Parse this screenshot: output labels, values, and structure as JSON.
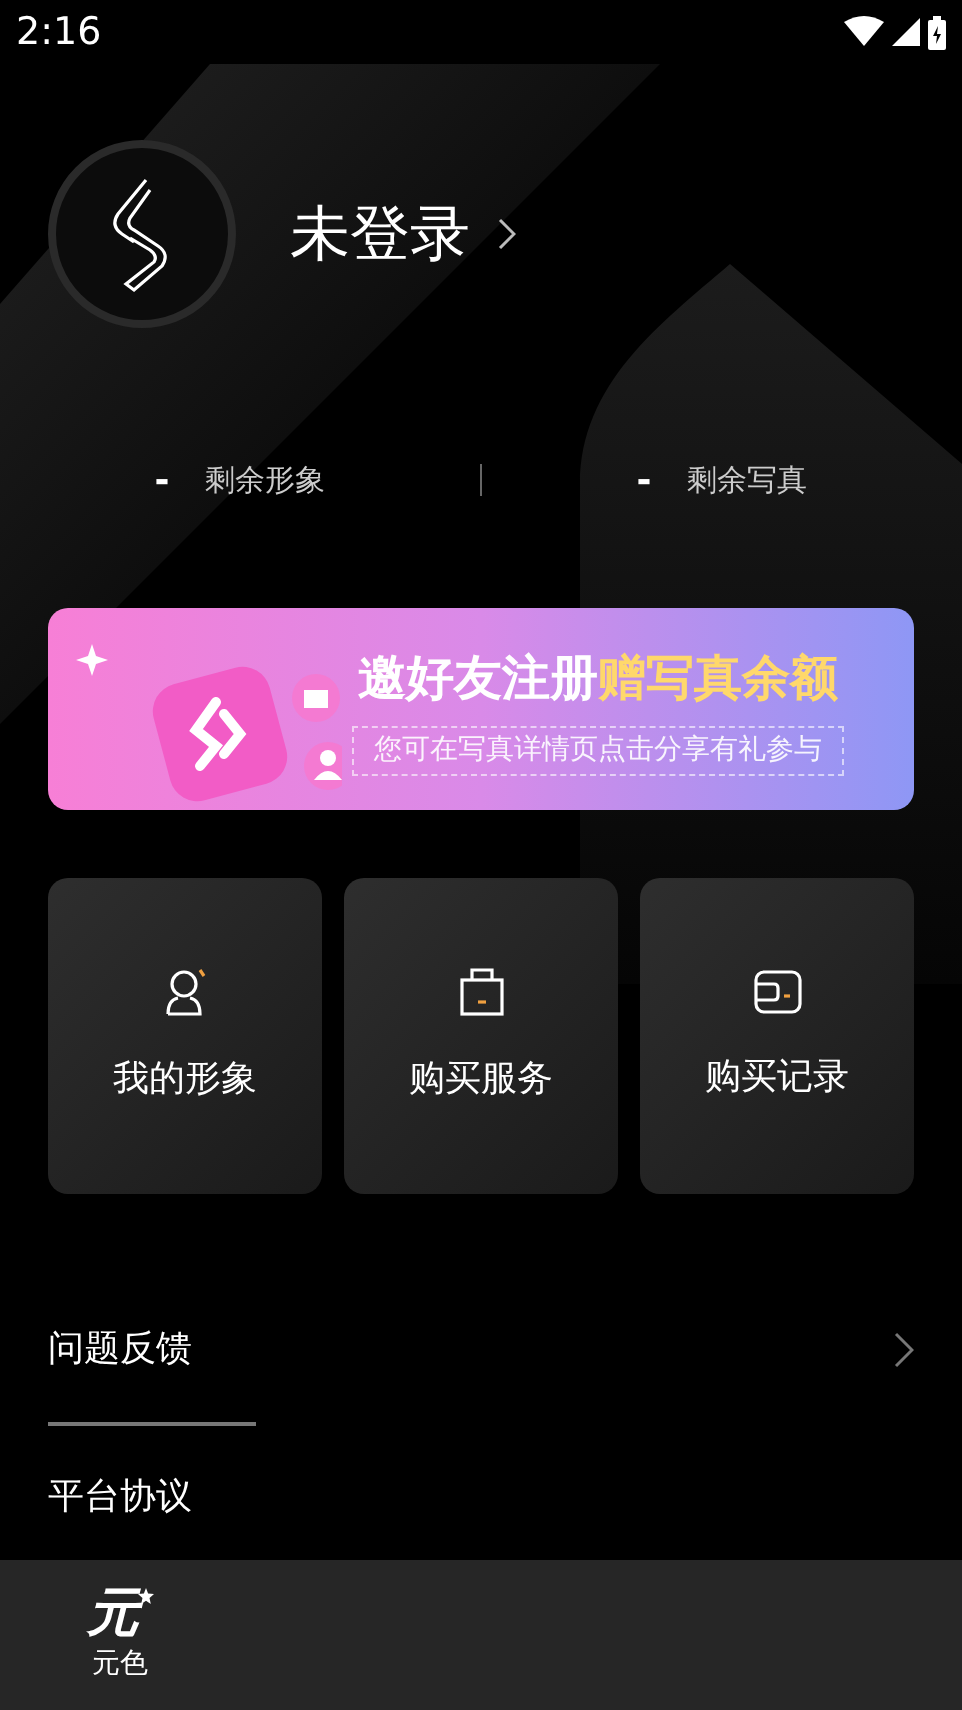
{
  "status_bar": {
    "time": "2:16"
  },
  "profile": {
    "name": "未登录"
  },
  "stats": [
    {
      "value": "-",
      "label": "剩余形象"
    },
    {
      "value": "-",
      "label": "剩余写真"
    }
  ],
  "banner": {
    "title": "邀好友注册",
    "highlight": "赠写真余额",
    "subtitle": "您可在写真详情页点击分享有礼参与"
  },
  "cards": [
    {
      "kind": "avatar",
      "label": "我的形象"
    },
    {
      "kind": "bag",
      "label": "购买服务"
    },
    {
      "kind": "wallet",
      "label": "购买记录"
    }
  ],
  "menu": [
    {
      "label": "问题反馈",
      "chevron": true
    },
    {
      "label": "平台协议",
      "chevron": false
    }
  ],
  "bottom_nav": [
    {
      "logo": "元",
      "label": "元色",
      "selected": true
    }
  ]
}
